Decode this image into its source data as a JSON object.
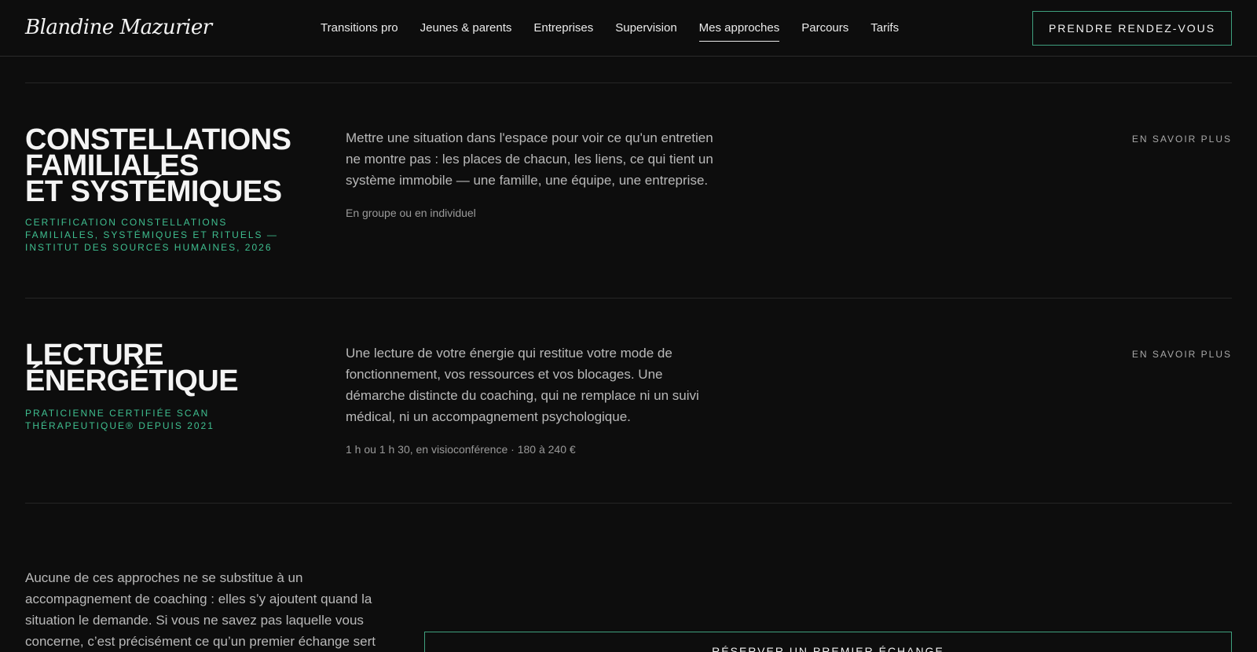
{
  "header": {
    "logo": "Blandine Mazurier",
    "nav": [
      {
        "label": "Transitions pro"
      },
      {
        "label": "Jeunes & parents"
      },
      {
        "label": "Entreprises"
      },
      {
        "label": "Supervision"
      },
      {
        "label": "Mes approches",
        "active": true
      },
      {
        "label": "Parcours"
      },
      {
        "label": "Tarifs"
      }
    ],
    "cta": "PRENDRE RENDEZ-VOUS"
  },
  "sections": [
    {
      "title": "Constellations\nfamiliales\net systémiques",
      "certification": "Certification constellations familiales, systémiques et rituels — Institut des Sources Humaines, 2026",
      "description": "Mettre une situation dans l'espace pour voir ce qu'un entretien ne montre pas : les places de chacun, les liens, ce qui tient un système immobile — une famille, une équipe, une entreprise.",
      "meta": "En groupe ou en individuel",
      "more": "EN SAVOIR PLUS"
    },
    {
      "title": "Lecture\nénergétique",
      "certification": "Praticienne certifiée Scan Thérapeutique® depuis 2021",
      "description": "Une lecture de votre énergie qui restitue votre mode de fonctionnement, vos ressources et vos blocages. Une démarche distincte du coaching, qui ne remplace ni un suivi médical, ni un accompagnement psychologique.",
      "meta": "1 h ou 1 h 30, en visioconférence · 180 à 240 €",
      "more": "EN SAVOIR PLUS"
    }
  ],
  "footer": {
    "text": "Aucune de ces approches ne se substitue à un accompagnement de coaching : elles s’y ajoutent quand la situation le demande. Si vous ne savez pas laquelle vous concerne, c’est précisément ce qu’un premier échange sert à",
    "cta": "RÉSERVER UN PREMIER ÉCHANGE"
  },
  "colors": {
    "background": "#0d0d0d",
    "accent": "#3fbf90",
    "border_accent": "#3fa07e",
    "text": "#ececec",
    "muted": "#b9b9b9"
  }
}
